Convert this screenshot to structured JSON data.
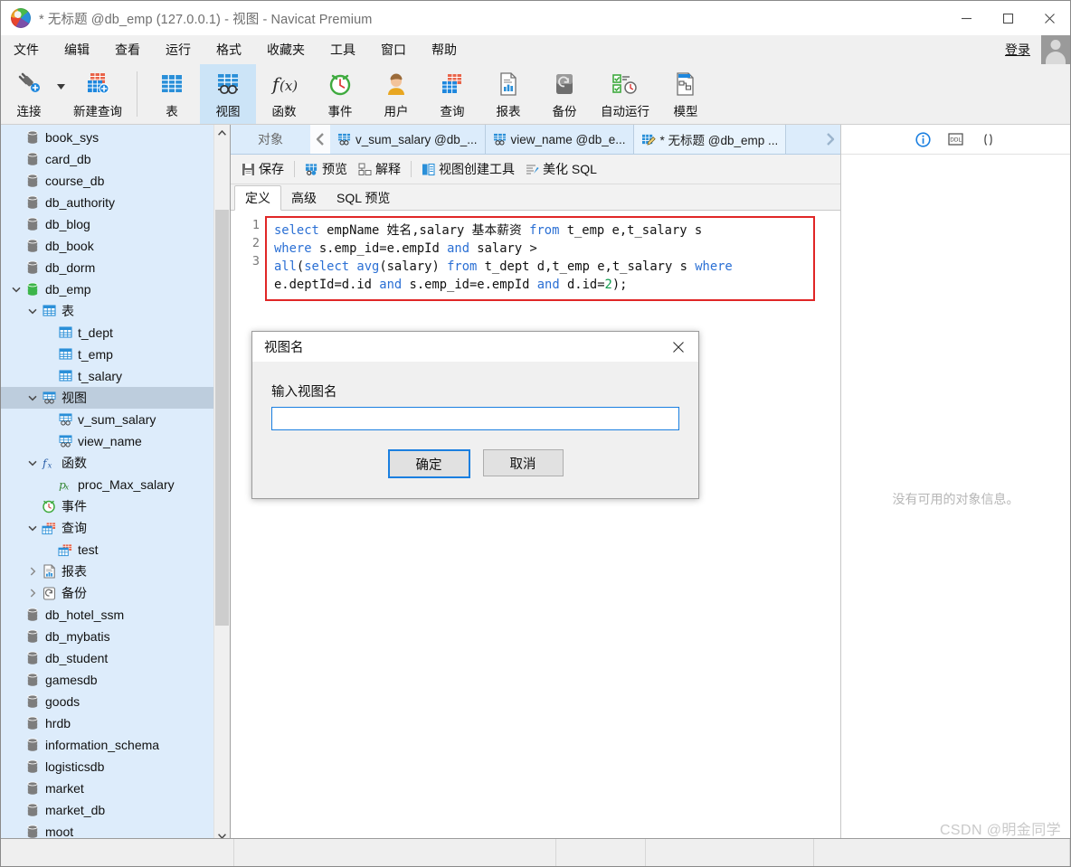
{
  "window": {
    "title": "* 无标题 @db_emp (127.0.0.1) - 视图 - Navicat Premium",
    "minimize": "—",
    "maximize": "▢",
    "close": "✕"
  },
  "menubar": {
    "items": [
      "文件",
      "编辑",
      "查看",
      "运行",
      "格式",
      "收藏夹",
      "工具",
      "窗口",
      "帮助"
    ],
    "login_label": "登录"
  },
  "toolbar": {
    "items": [
      {
        "label": "连接",
        "icon": "connection-icon",
        "active": false
      },
      {
        "label": "新建查询",
        "icon": "new-query-icon",
        "active": false
      },
      {
        "label": "表",
        "icon": "table-icon",
        "active": false
      },
      {
        "label": "视图",
        "icon": "view-icon",
        "active": true
      },
      {
        "label": "函数",
        "icon": "function-fx-icon",
        "active": false
      },
      {
        "label": "事件",
        "icon": "event-clock-icon",
        "active": false
      },
      {
        "label": "用户",
        "icon": "user-icon",
        "active": false
      },
      {
        "label": "查询",
        "icon": "query-icon",
        "active": false
      },
      {
        "label": "报表",
        "icon": "report-icon",
        "active": false
      },
      {
        "label": "备份",
        "icon": "backup-icon",
        "active": false
      },
      {
        "label": "自动运行",
        "icon": "automation-icon",
        "active": false
      },
      {
        "label": "模型",
        "icon": "model-icon",
        "active": false
      }
    ]
  },
  "sidebar": {
    "nodes": [
      {
        "label": "book_sys",
        "indent": 1,
        "icon": "database-icon",
        "arrow": "",
        "selected": false
      },
      {
        "label": "card_db",
        "indent": 1,
        "icon": "database-icon",
        "arrow": "",
        "selected": false
      },
      {
        "label": "course_db",
        "indent": 1,
        "icon": "database-icon",
        "arrow": "",
        "selected": false
      },
      {
        "label": "db_authority",
        "indent": 1,
        "icon": "database-icon",
        "arrow": "",
        "selected": false
      },
      {
        "label": "db_blog",
        "indent": 1,
        "icon": "database-icon",
        "arrow": "",
        "selected": false
      },
      {
        "label": "db_book",
        "indent": 1,
        "icon": "database-icon",
        "arrow": "",
        "selected": false
      },
      {
        "label": "db_dorm",
        "indent": 1,
        "icon": "database-icon",
        "arrow": "",
        "selected": false
      },
      {
        "label": "db_emp",
        "indent": 1,
        "icon": "database-open-icon",
        "arrow": "down",
        "selected": false
      },
      {
        "label": "表",
        "indent": 2,
        "icon": "table-icon",
        "arrow": "down",
        "selected": false
      },
      {
        "label": "t_dept",
        "indent": 3,
        "icon": "table-icon",
        "arrow": "",
        "selected": false
      },
      {
        "label": "t_emp",
        "indent": 3,
        "icon": "table-icon",
        "arrow": "",
        "selected": false
      },
      {
        "label": "t_salary",
        "indent": 3,
        "icon": "table-icon",
        "arrow": "",
        "selected": false
      },
      {
        "label": "视图",
        "indent": 2,
        "icon": "view-icon",
        "arrow": "down",
        "selected": true
      },
      {
        "label": "v_sum_salary",
        "indent": 3,
        "icon": "view-icon",
        "arrow": "",
        "selected": false
      },
      {
        "label": "view_name",
        "indent": 3,
        "icon": "view-icon",
        "arrow": "",
        "selected": false
      },
      {
        "label": "函数",
        "indent": 2,
        "icon": "function-fx-icon",
        "arrow": "down",
        "selected": false
      },
      {
        "label": "proc_Max_salary",
        "indent": 3,
        "icon": "procedure-px-icon",
        "arrow": "",
        "selected": false
      },
      {
        "label": "事件",
        "indent": 2,
        "icon": "event-clock-icon",
        "arrow": "",
        "selected": false
      },
      {
        "label": "查询",
        "indent": 2,
        "icon": "query-icon",
        "arrow": "down",
        "selected": false
      },
      {
        "label": "test",
        "indent": 3,
        "icon": "query-icon",
        "arrow": "",
        "selected": false
      },
      {
        "label": "报表",
        "indent": 2,
        "icon": "report-icon",
        "arrow": "right",
        "selected": false
      },
      {
        "label": "备份",
        "indent": 2,
        "icon": "backup-icon",
        "arrow": "right",
        "selected": false
      },
      {
        "label": "db_hotel_ssm",
        "indent": 1,
        "icon": "database-icon",
        "arrow": "",
        "selected": false
      },
      {
        "label": "db_mybatis",
        "indent": 1,
        "icon": "database-icon",
        "arrow": "",
        "selected": false
      },
      {
        "label": "db_student",
        "indent": 1,
        "icon": "database-icon",
        "arrow": "",
        "selected": false
      },
      {
        "label": "gamesdb",
        "indent": 1,
        "icon": "database-icon",
        "arrow": "",
        "selected": false
      },
      {
        "label": "goods",
        "indent": 1,
        "icon": "database-icon",
        "arrow": "",
        "selected": false
      },
      {
        "label": "hrdb",
        "indent": 1,
        "icon": "database-icon",
        "arrow": "",
        "selected": false
      },
      {
        "label": "information_schema",
        "indent": 1,
        "icon": "database-icon",
        "arrow": "",
        "selected": false
      },
      {
        "label": "logisticsdb",
        "indent": 1,
        "icon": "database-icon",
        "arrow": "",
        "selected": false
      },
      {
        "label": "market",
        "indent": 1,
        "icon": "database-icon",
        "arrow": "",
        "selected": false
      },
      {
        "label": "market_db",
        "indent": 1,
        "icon": "database-icon",
        "arrow": "",
        "selected": false
      },
      {
        "label": "moot",
        "indent": 1,
        "icon": "database-icon",
        "arrow": "",
        "selected": false
      }
    ]
  },
  "tabbar": {
    "object_label": "对象",
    "prev_icon": "chevron-left-icon",
    "next_icon": "chevron-right-icon",
    "tabs": [
      {
        "label": "v_sum_salary @db_...",
        "icon": "view-icon",
        "active": false
      },
      {
        "label": "view_name @db_e...",
        "icon": "view-icon",
        "active": false
      },
      {
        "label": "* 无标题 @db_emp ...",
        "icon": "view-edit-icon",
        "active": true
      }
    ]
  },
  "subtoolbar": {
    "buttons": [
      {
        "label": "保存",
        "icon": "save-icon"
      },
      {
        "label": "预览",
        "icon": "preview-icon"
      },
      {
        "label": "解释",
        "icon": "explain-icon"
      },
      {
        "label": "视图创建工具",
        "icon": "view-builder-icon"
      },
      {
        "label": "美化 SQL",
        "icon": "beautify-sql-icon"
      }
    ]
  },
  "editor_tabs": {
    "items": [
      {
        "label": "定义",
        "active": true
      },
      {
        "label": "高级",
        "active": false
      },
      {
        "label": "SQL 预览",
        "active": false
      }
    ]
  },
  "editor": {
    "line_numbers": [
      "1",
      "2",
      "3"
    ],
    "sql_lines": [
      "select empName 姓名,salary 基本薪资 from t_emp e,t_salary s",
      "where s.emp_id=e.empId and salary >",
      "all(select avg(salary) from t_dept d,t_emp e,t_salary s where e.deptId=d.id and s.emp_id=e.empId and d.id=2);"
    ],
    "border_color": "#e02626"
  },
  "right_panel": {
    "icons": [
      "info-icon",
      "ddl-icon",
      "parentheses-icon"
    ],
    "empty_text": "没有可用的对象信息。"
  },
  "dialog": {
    "title": "视图名",
    "close_icon": "close-icon",
    "field_label": "输入视图名",
    "input_value": "",
    "input_placeholder": "",
    "ok_label": "确定",
    "cancel_label": "取消"
  },
  "watermark": "CSDN @明金同学"
}
